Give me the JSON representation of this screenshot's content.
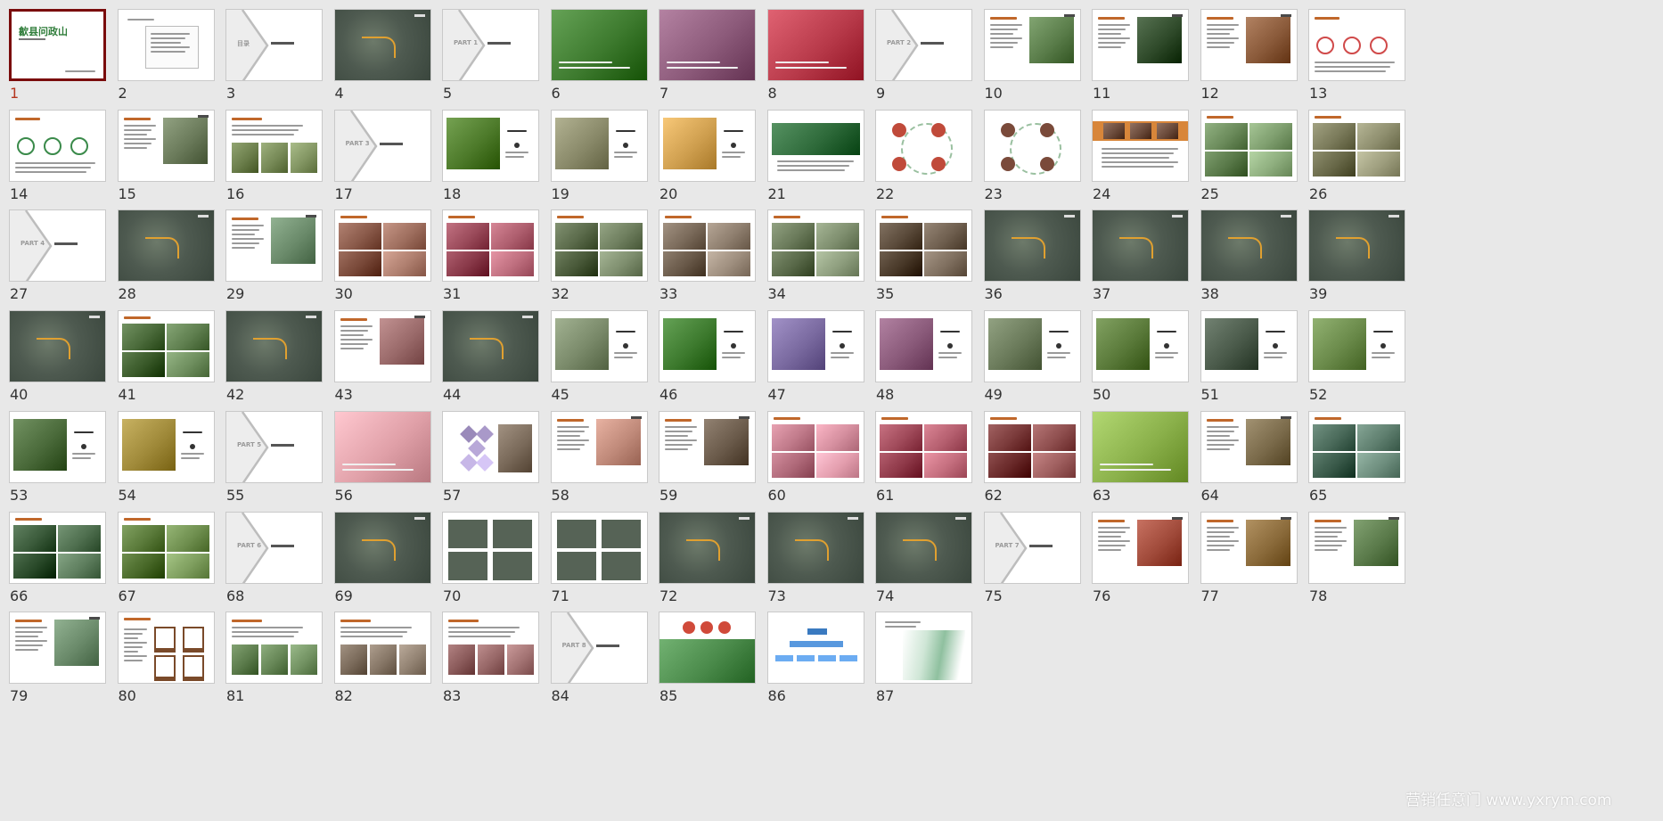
{
  "view": {
    "title_slide_text": "歙县问政山",
    "watermark": "营销任意门 www.yxrym.com",
    "selected": 1
  },
  "slides": [
    {
      "n": "1",
      "kind": "title"
    },
    {
      "n": "2",
      "kind": "doc"
    },
    {
      "n": "3",
      "kind": "part",
      "label": "目录"
    },
    {
      "n": "4",
      "kind": "map"
    },
    {
      "n": "5",
      "kind": "part",
      "label": "PART 1"
    },
    {
      "n": "6",
      "kind": "photo",
      "color": "#3d7a2e"
    },
    {
      "n": "7",
      "kind": "photo",
      "color": "#8c5a7a"
    },
    {
      "n": "8",
      "kind": "photo",
      "color": "#b83a4a"
    },
    {
      "n": "9",
      "kind": "part",
      "label": "PART 2"
    },
    {
      "n": "10",
      "kind": "textphoto",
      "color": "#5a7d4a"
    },
    {
      "n": "11",
      "kind": "textphoto",
      "color": "#2f4a2a"
    },
    {
      "n": "12",
      "kind": "textphoto",
      "color": "#8a5a3a"
    },
    {
      "n": "13",
      "kind": "diagram",
      "color": "#d04a4a"
    },
    {
      "n": "14",
      "kind": "diagram",
      "color": "#3a8a4a"
    },
    {
      "n": "15",
      "kind": "textphoto",
      "color": "#6a7a5a"
    },
    {
      "n": "16",
      "kind": "strip",
      "color": "#6a7d4a"
    },
    {
      "n": "17",
      "kind": "part",
      "label": "PART 3"
    },
    {
      "n": "18",
      "kind": "photoleft",
      "color": "#4d7a2a"
    },
    {
      "n": "19",
      "kind": "photoleft",
      "color": "#8a8a6a"
    },
    {
      "n": "20",
      "kind": "photoleft",
      "color": "#d0a050"
    },
    {
      "n": "21",
      "kind": "banner",
      "color": "#2e6a3a"
    },
    {
      "n": "22",
      "kind": "cycle",
      "color": "#c04a3a"
    },
    {
      "n": "23",
      "kind": "cycle",
      "color": "#7a4a3a"
    },
    {
      "n": "24",
      "kind": "orange",
      "color": "#d8863a"
    },
    {
      "n": "25",
      "kind": "grid4",
      "color": "#6a8a5a"
    },
    {
      "n": "26",
      "kind": "grid4",
      "color": "#7a7a5a"
    },
    {
      "n": "27",
      "kind": "part",
      "label": "PART 4"
    },
    {
      "n": "28",
      "kind": "map"
    },
    {
      "n": "29",
      "kind": "textphoto",
      "color": "#6a8a6a"
    },
    {
      "n": "30",
      "kind": "grid4",
      "color": "#8a5a4a"
    },
    {
      "n": "31",
      "kind": "grid4",
      "color": "#9a4a5a"
    },
    {
      "n": "32",
      "kind": "grid4",
      "color": "#5a6a4a"
    },
    {
      "n": "33",
      "kind": "grid4",
      "color": "#7a6a5a"
    },
    {
      "n": "34",
      "kind": "grid4",
      "color": "#6a7a5a"
    },
    {
      "n": "35",
      "kind": "grid4",
      "color": "#5a4a3a"
    },
    {
      "n": "36",
      "kind": "map"
    },
    {
      "n": "37",
      "kind": "map"
    },
    {
      "n": "38",
      "kind": "map"
    },
    {
      "n": "39",
      "kind": "map"
    },
    {
      "n": "40",
      "kind": "map"
    },
    {
      "n": "41",
      "kind": "grid4",
      "color": "#4a6a3a"
    },
    {
      "n": "42",
      "kind": "map"
    },
    {
      "n": "43",
      "kind": "textphoto",
      "color": "#9a6a6a"
    },
    {
      "n": "44",
      "kind": "map"
    },
    {
      "n": "45",
      "kind": "photoleft",
      "color": "#7a8a6a"
    },
    {
      "n": "46",
      "kind": "photoleft",
      "color": "#3d7a2e"
    },
    {
      "n": "47",
      "kind": "photoleft",
      "color": "#7a6aa0"
    },
    {
      "n": "48",
      "kind": "photoleft",
      "color": "#8a5a7a"
    },
    {
      "n": "49",
      "kind": "photoleft",
      "color": "#6a7a5a"
    },
    {
      "n": "50",
      "kind": "photoleft",
      "color": "#5a7a3a"
    },
    {
      "n": "51",
      "kind": "photoleft",
      "color": "#4a5a4a"
    },
    {
      "n": "52",
      "kind": "photoleft",
      "color": "#6a8a4a"
    },
    {
      "n": "53",
      "kind": "photoleft",
      "color": "#4a6a3a"
    },
    {
      "n": "54",
      "kind": "photoleft",
      "color": "#a08a3a"
    },
    {
      "n": "55",
      "kind": "part",
      "label": "PART 5"
    },
    {
      "n": "56",
      "kind": "photo",
      "color": "#e0a0a8"
    },
    {
      "n": "57",
      "kind": "diamond",
      "color": "#9a8aba"
    },
    {
      "n": "58",
      "kind": "textphoto",
      "color": "#c08a7a"
    },
    {
      "n": "59",
      "kind": "textphoto",
      "color": "#6a5a4a"
    },
    {
      "n": "60",
      "kind": "grid4",
      "color": "#c07a8a"
    },
    {
      "n": "61",
      "kind": "grid4",
      "color": "#a04a5a"
    },
    {
      "n": "62",
      "kind": "grid4",
      "color": "#7a3a3a"
    },
    {
      "n": "63",
      "kind": "photo",
      "color": "#8ab04a"
    },
    {
      "n": "64",
      "kind": "textphoto",
      "color": "#7a6a4a"
    },
    {
      "n": "65",
      "kind": "grid4",
      "color": "#4a6a5a"
    },
    {
      "n": "66",
      "kind": "grid4",
      "color": "#3a5a3a"
    },
    {
      "n": "67",
      "kind": "grid4",
      "color": "#5a7a3a"
    },
    {
      "n": "68",
      "kind": "part",
      "label": "PART 6"
    },
    {
      "n": "69",
      "kind": "map"
    },
    {
      "n": "70",
      "kind": "mapgrid"
    },
    {
      "n": "71",
      "kind": "mapgrid"
    },
    {
      "n": "72",
      "kind": "map"
    },
    {
      "n": "73",
      "kind": "map"
    },
    {
      "n": "74",
      "kind": "map"
    },
    {
      "n": "75",
      "kind": "part",
      "label": "PART 7"
    },
    {
      "n": "76",
      "kind": "textphoto",
      "color": "#a04a3a"
    },
    {
      "n": "77",
      "kind": "textphoto",
      "color": "#8a6a3a"
    },
    {
      "n": "78",
      "kind": "textphoto",
      "color": "#5a7a4a"
    },
    {
      "n": "79",
      "kind": "textphoto",
      "color": "#6a8a6a"
    },
    {
      "n": "80",
      "kind": "furniture",
      "color": "#7a4a2a"
    },
    {
      "n": "81",
      "kind": "strip",
      "color": "#5a7a4a"
    },
    {
      "n": "82",
      "kind": "strip",
      "color": "#7a6a5a"
    },
    {
      "n": "83",
      "kind": "strip",
      "color": "#8a5a5a"
    },
    {
      "n": "84",
      "kind": "part",
      "label": "PART 8"
    },
    {
      "n": "85",
      "kind": "scenic",
      "color": "#4a8a4a"
    },
    {
      "n": "86",
      "kind": "orgchart",
      "color": "#3a7ac0"
    },
    {
      "n": "87",
      "kind": "bamboo",
      "color": "#5a9a6a"
    }
  ]
}
